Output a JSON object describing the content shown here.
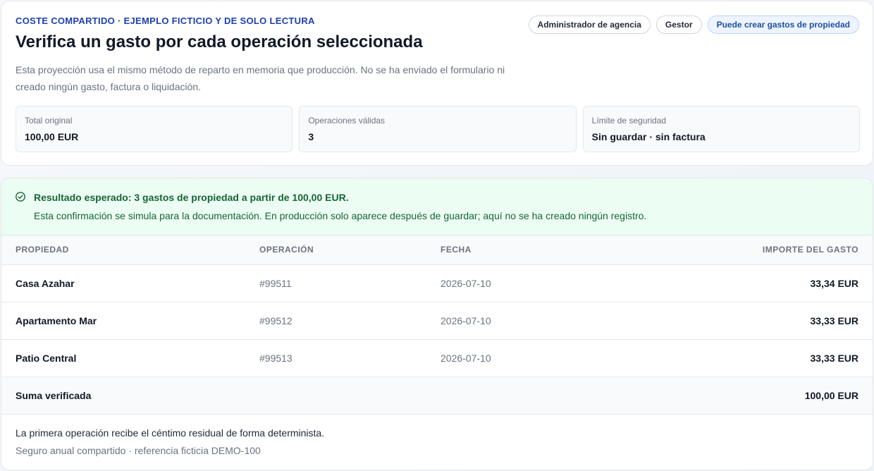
{
  "header": {
    "eyebrow": "COSTE COMPARTIDO · EJEMPLO FICTICIO Y DE SOLO LECTURA",
    "title": "Verifica un gasto por cada operación seleccionada",
    "description": "Esta proyección usa el mismo método de reparto en memoria que producción. No se ha enviado el formulario ni creado ningún gasto, factura o liquidación.",
    "badges": [
      "Administrador de agencia",
      "Gestor",
      "Puede crear gastos de propiedad"
    ]
  },
  "metrics": [
    {
      "label": "Total original",
      "value": "100,00 EUR"
    },
    {
      "label": "Operaciones válidas",
      "value": "3"
    },
    {
      "label": "Límite de seguridad",
      "value": "Sin guardar · sin factura"
    }
  ],
  "alert": {
    "title": "Resultado esperado: 3 gastos de propiedad a partir de 100,00 EUR.",
    "body": "Esta confirmación se simula para la documentación. En producción solo aparece después de guardar; aquí no se ha creado ningún registro.",
    "icon": "check-circle-icon",
    "color": "#166534"
  },
  "table": {
    "columns": [
      "PROPIEDAD",
      "OPERACIÓN",
      "FECHA",
      "IMPORTE DEL GASTO"
    ],
    "rows": [
      {
        "property": "Casa Azahar",
        "operation": "#99511",
        "date": "2026-07-10",
        "amount": "33,34 EUR"
      },
      {
        "property": "Apartamento Mar",
        "operation": "#99512",
        "date": "2026-07-10",
        "amount": "33,33 EUR"
      },
      {
        "property": "Patio Central",
        "operation": "#99513",
        "date": "2026-07-10",
        "amount": "33,33 EUR"
      }
    ],
    "total_label": "Suma verificada",
    "total_value": "100,00 EUR"
  },
  "footnote": {
    "main": "La primera operación recibe el céntimo residual de forma determinista.",
    "sub": "Seguro anual compartido · referencia ficticia DEMO-100"
  },
  "colors": {
    "accent": "#1e40af",
    "success_bg": "#ecfdf3",
    "success_text": "#166534"
  }
}
